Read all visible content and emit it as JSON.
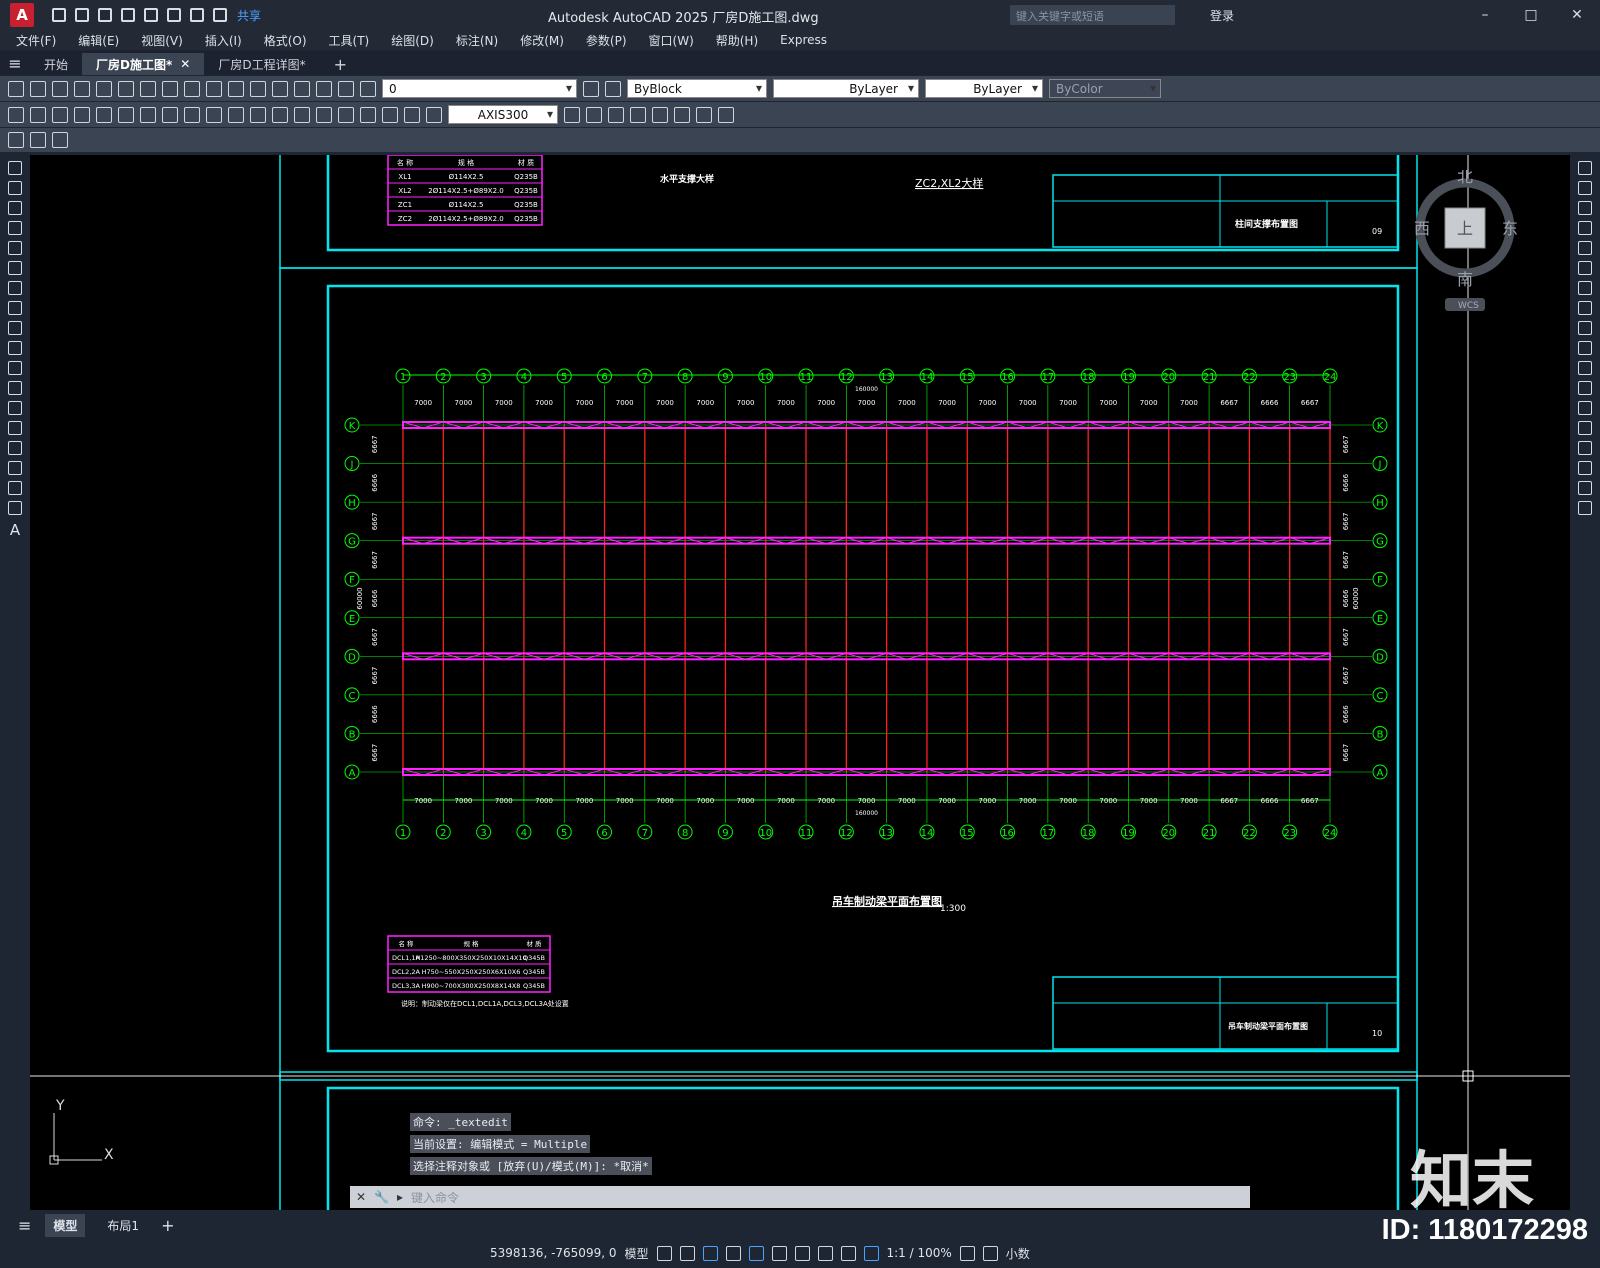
{
  "app": {
    "logo_letter": "A",
    "share_label": "共享",
    "window_title": "Autodesk AutoCAD 2025    厂房D施工图.dwg",
    "search_placeholder": "键入关键字或短语",
    "login_label": "登录"
  },
  "menu": [
    "文件(F)",
    "编辑(E)",
    "视图(V)",
    "插入(I)",
    "格式(O)",
    "工具(T)",
    "绘图(D)",
    "标注(N)",
    "修改(M)",
    "参数(P)",
    "窗口(W)",
    "帮助(H)",
    "Express"
  ],
  "tabs": [
    {
      "label": "开始"
    },
    {
      "label": "厂房D施工图*"
    },
    {
      "label": "厂房D工程详图*"
    }
  ],
  "properties": {
    "layer_value": "0",
    "color_value": "ByBlock",
    "linetype_value": "ByLayer",
    "lineweight_value": "ByLayer",
    "plotstyle_value": "ByColor",
    "dimstyle_value": "AXIS300"
  },
  "viewcube": {
    "north": "北",
    "south": "南",
    "west": "西",
    "east": "东",
    "top": "上",
    "wcs": "WCS"
  },
  "drawing": {
    "plan_title": "吊车制动梁平面布置图",
    "plan_scale": "1:300",
    "top_sheet_title": "柱间支撑布置图",
    "top_sheet_number": "09",
    "bottom_sheet_number": "10",
    "support_caption_1": "水平支撑大样",
    "support_caption_2": "ZC2,XL2大样",
    "top_spacing_total": "160000",
    "bottom_spacing_total": "160000",
    "col_axes": [
      "1",
      "2",
      "3",
      "4",
      "5",
      "6",
      "7",
      "8",
      "9",
      "10",
      "11",
      "12",
      "13",
      "14",
      "15",
      "16",
      "17",
      "18",
      "19",
      "20",
      "21",
      "22",
      "23",
      "24"
    ],
    "col_spacings": [
      "7000",
      "7000",
      "7000",
      "7000",
      "7000",
      "7000",
      "7000",
      "7000",
      "7000",
      "7000",
      "7000",
      "7000",
      "7000",
      "7000",
      "7000",
      "7000",
      "7000",
      "7000",
      "7000",
      "7000",
      "6667",
      "6666",
      "6667"
    ],
    "row_axes": [
      "K",
      "J",
      "H",
      "G",
      "F",
      "E",
      "D",
      "C",
      "B",
      "A"
    ],
    "row_spacings": [
      "6667",
      "6666",
      "6667",
      "6667",
      "6666",
      "6667",
      "6667",
      "6666",
      "6667"
    ],
    "row_total": "60000",
    "upper_table": {
      "headers": [
        "名 称",
        "规 格",
        "材 质"
      ],
      "rows": [
        [
          "XL1",
          "Ø114X2.5",
          "Q235B"
        ],
        [
          "XL2",
          "2Ø114X2.5+Ø89X2.0",
          "Q235B"
        ],
        [
          "ZC1",
          "Ø114X2.5",
          "Q235B"
        ],
        [
          "ZC2",
          "2Ø114X2.5+Ø89X2.0",
          "Q235B"
        ]
      ]
    },
    "lower_table": {
      "headers": [
        "名 称",
        "规 格",
        "材 质"
      ],
      "rows": [
        [
          "DCL1,1A",
          "H1250~800X350X250X10X14X10",
          "Q345B"
        ],
        [
          "DCL2,2A",
          "H750~550X250X250X6X10X6",
          "Q345B"
        ],
        [
          "DCL3,3A",
          "H900~700X300X250X8X14X8",
          "Q345B"
        ]
      ],
      "note": "说明：制动梁仅在DCL1,DCL1A,DCL3,DCL3A处设置"
    }
  },
  "command": {
    "history": [
      "命令: _textedit",
      "当前设置: 编辑模式 = Multiple",
      "选择注释对象或 [放弃(U)/模式(M)]: *取消*"
    ],
    "placeholder": "键入命令"
  },
  "layouts": [
    "模型",
    "布局1"
  ],
  "status": {
    "coords": "5398136, -765099, 0",
    "space": "模型",
    "scale": "1:1 / 100%",
    "units": "小数"
  },
  "watermark": {
    "brand": "知末",
    "id_text": "ID: 1180172298"
  },
  "colors": {
    "frame": "#00e5ee",
    "grid_lines": "#00ff00",
    "beam": "#ff22ff",
    "columns": "#ff2020",
    "accent": "#49a3ff"
  }
}
